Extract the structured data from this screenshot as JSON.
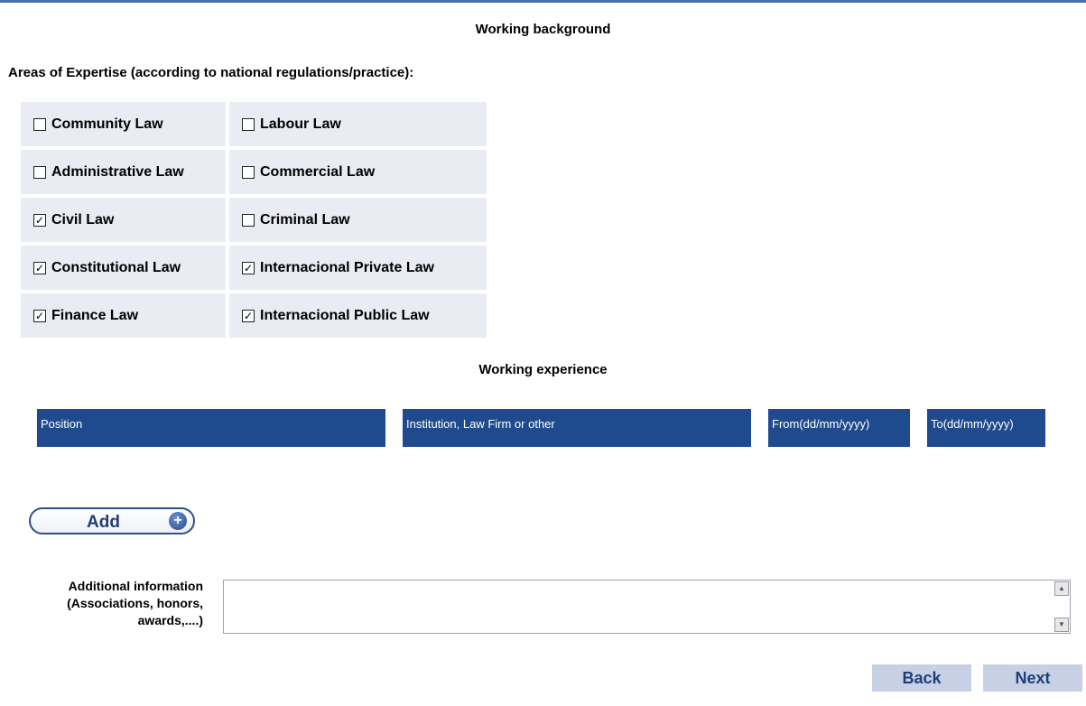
{
  "title": "Working background",
  "areas": {
    "label": "Areas of Expertise (according to national regulations/practice):",
    "items": [
      {
        "label": "Community Law",
        "checked": false
      },
      {
        "label": "Labour Law",
        "checked": false
      },
      {
        "label": "Administrative Law",
        "checked": false
      },
      {
        "label": "Commercial Law",
        "checked": false
      },
      {
        "label": "Civil Law",
        "checked": true
      },
      {
        "label": "Criminal Law",
        "checked": false
      },
      {
        "label": "Constitutional Law",
        "checked": true
      },
      {
        "label": "Internacional Private Law",
        "checked": true
      },
      {
        "label": "Finance Law",
        "checked": true
      },
      {
        "label": "Internacional Public Law",
        "checked": true
      }
    ]
  },
  "experience": {
    "title": "Working experience",
    "columns": [
      "Position",
      "Institution, Law Firm or other",
      "From(dd/mm/yyyy)",
      "To(dd/mm/yyyy)"
    ],
    "add_label": "Add"
  },
  "additional": {
    "label_lines": [
      "Additional information",
      "(Associations, honors,",
      "awards,....)"
    ],
    "value": ""
  },
  "nav": {
    "back": "Back",
    "next": "Next"
  },
  "colors": {
    "header_blue": "#1f4a8e",
    "cell_bg": "#eaecf4",
    "nav_button_bg": "#c7d0e4"
  }
}
